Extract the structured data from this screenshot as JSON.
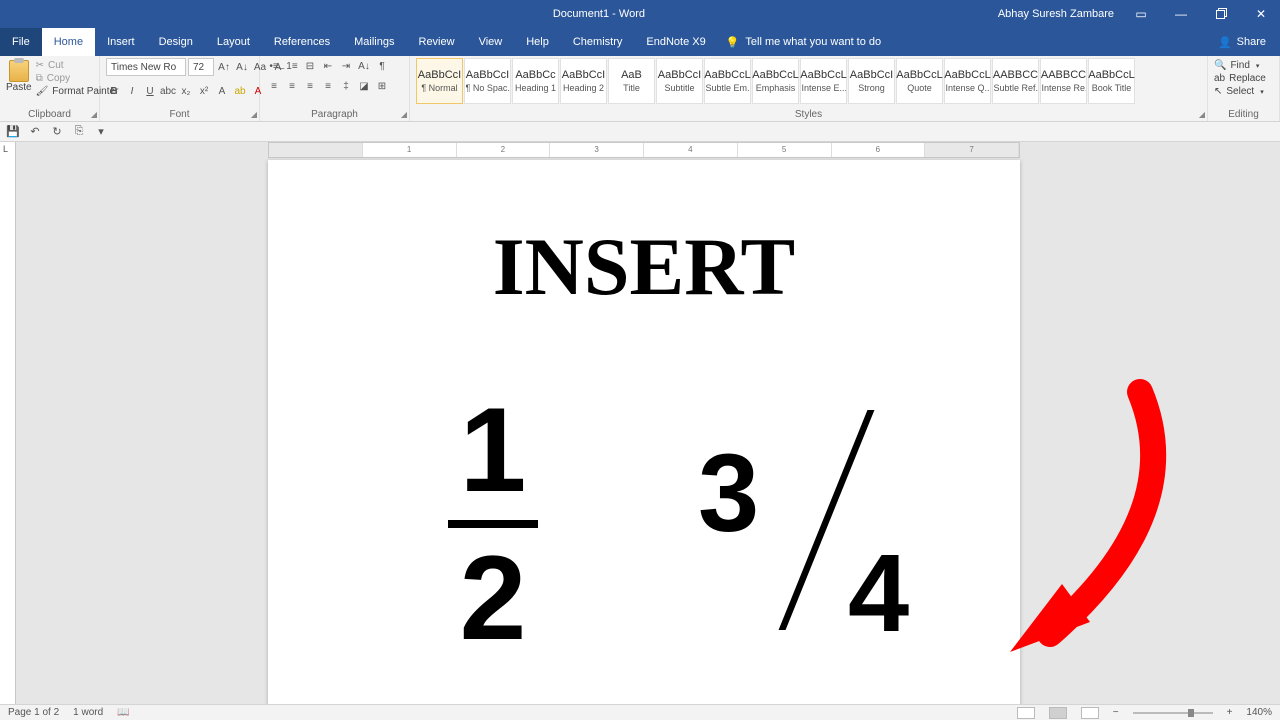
{
  "titlebar": {
    "title": "Document1 - Word",
    "user": "Abhay Suresh Zambare"
  },
  "menu": {
    "file": "File",
    "home": "Home",
    "insert": "Insert",
    "design": "Design",
    "layout": "Layout",
    "references": "References",
    "mailings": "Mailings",
    "review": "Review",
    "view": "View",
    "help": "Help",
    "chemistry": "Chemistry",
    "endnote": "EndNote X9",
    "tell": "Tell me what you want to do",
    "share": "Share"
  },
  "ribbon": {
    "clipboard": {
      "label": "Clipboard",
      "paste": "Paste",
      "cut": "Cut",
      "copy": "Copy",
      "formatpainter": "Format Painter"
    },
    "font": {
      "label": "Font",
      "name": "Times New Ro",
      "size": "72"
    },
    "paragraph": {
      "label": "Paragraph"
    },
    "styles": {
      "label": "Styles",
      "items": [
        {
          "name": "¶ Normal",
          "sample": "AaBbCcI",
          "sel": true,
          "cls": ""
        },
        {
          "name": "¶ No Spac...",
          "sample": "AaBbCcI",
          "cls": ""
        },
        {
          "name": "Heading 1",
          "sample": "AaBbCc",
          "cls": "blue"
        },
        {
          "name": "Heading 2",
          "sample": "AaBbCcI",
          "cls": "blue"
        },
        {
          "name": "Title",
          "sample": "AaB",
          "cls": ""
        },
        {
          "name": "Subtitle",
          "sample": "AaBbCcI",
          "cls": "blue"
        },
        {
          "name": "Subtle Em...",
          "sample": "AaBbCcL",
          "cls": "ital"
        },
        {
          "name": "Emphasis",
          "sample": "AaBbCcL",
          "cls": "ital"
        },
        {
          "name": "Intense E...",
          "sample": "AaBbCcL",
          "cls": "ital"
        },
        {
          "name": "Strong",
          "sample": "AaBbCcI",
          "cls": "bold"
        },
        {
          "name": "Quote",
          "sample": "AaBbCcL",
          "cls": "ital"
        },
        {
          "name": "Intense Q...",
          "sample": "AaBbCcL",
          "cls": "ital under"
        },
        {
          "name": "Subtle Ref...",
          "sample": "AABBCC",
          "cls": ""
        },
        {
          "name": "Intense Re...",
          "sample": "AABBCC",
          "cls": "blue"
        },
        {
          "name": "Book Title",
          "sample": "AaBbCcL",
          "cls": "ital bold"
        }
      ]
    },
    "editing": {
      "label": "Editing",
      "find": "Find",
      "replace": "Replace",
      "select": "Select"
    }
  },
  "document": {
    "heading": "INSERT",
    "fraction1": {
      "num": "1",
      "den": "2"
    },
    "fraction2": {
      "num": "3",
      "den": "4"
    }
  },
  "status": {
    "page": "Page 1 of 2",
    "words": "1 word",
    "zoom": "140%"
  }
}
